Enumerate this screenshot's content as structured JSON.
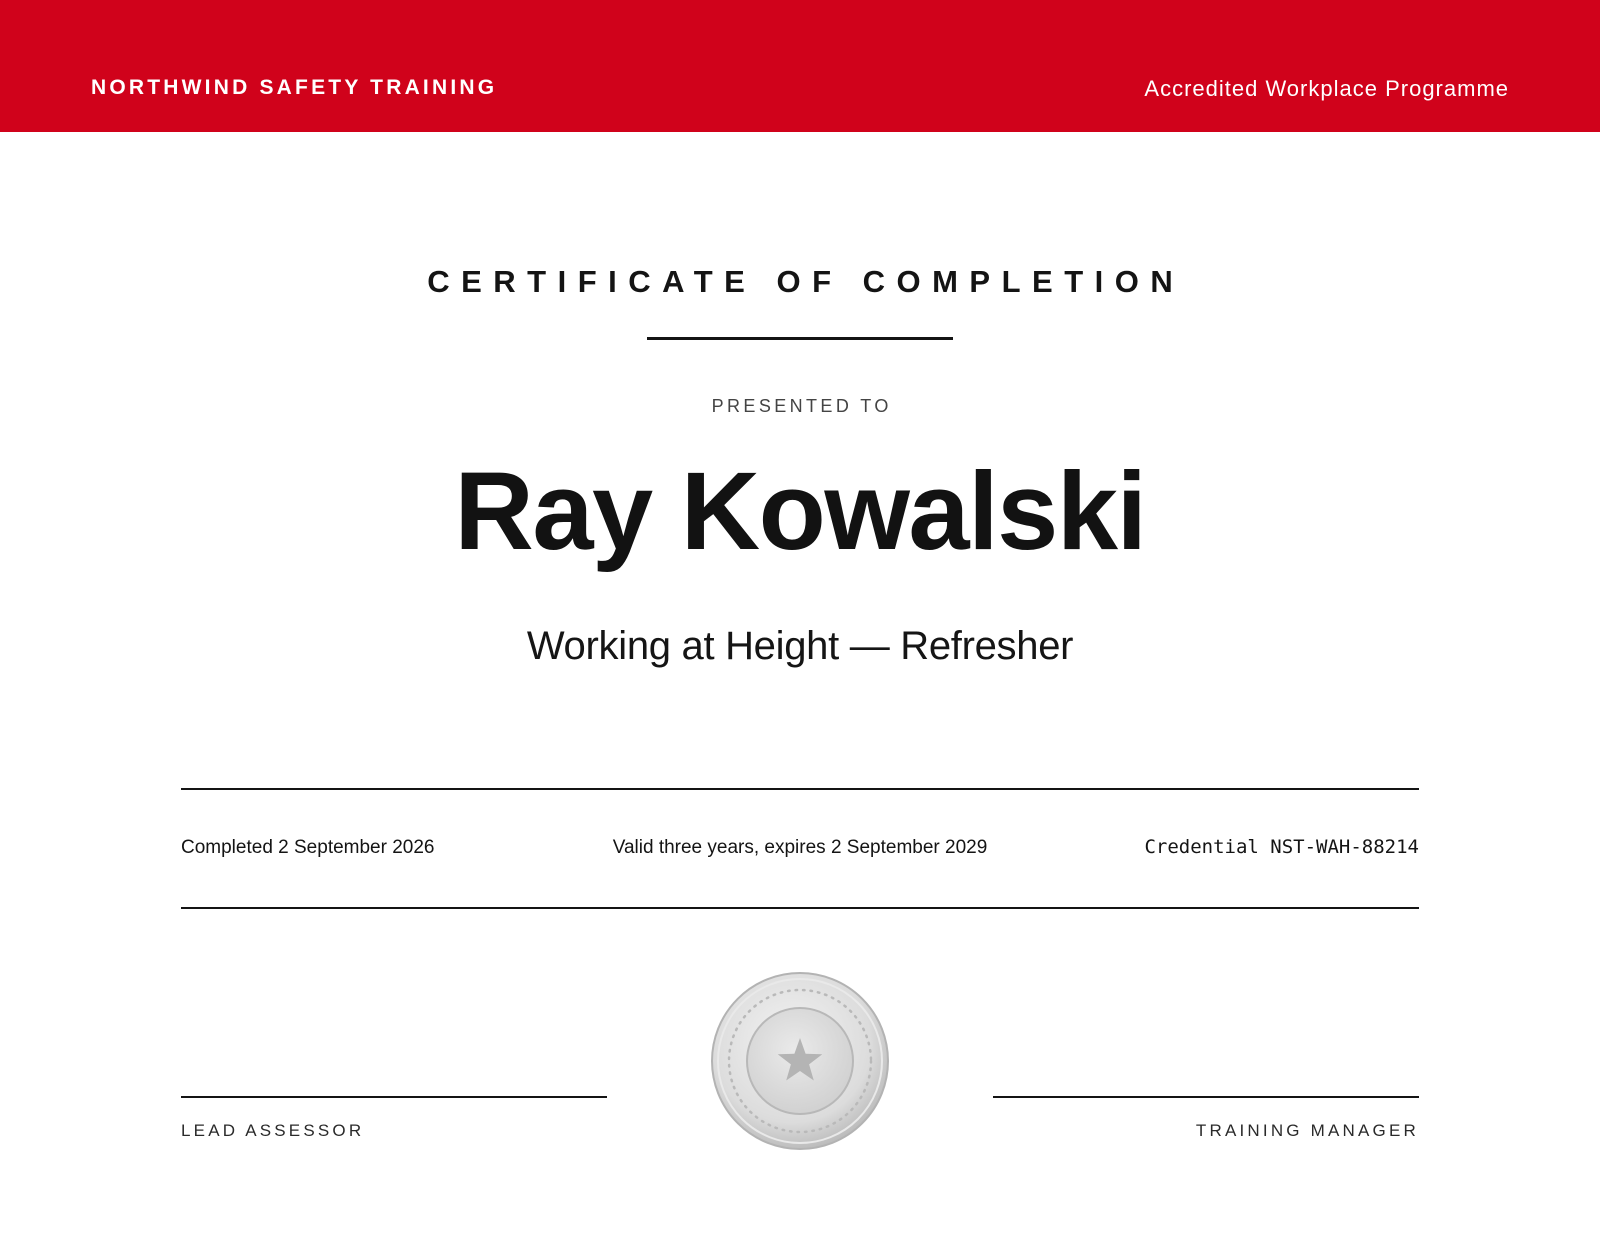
{
  "banner": {
    "organization": "NORTHWIND SAFETY TRAINING",
    "programme": "Accredited Workplace Programme",
    "color": "#d0021b"
  },
  "certificate": {
    "title": "CERTIFICATE OF COMPLETION",
    "presented_label": "PRESENTED TO",
    "recipient": "Ray Kowalski",
    "course": "Working at Height — Refresher"
  },
  "details": {
    "completed": "Completed 2 September 2026",
    "validity": "Valid three years, expires 2 September 2029",
    "credential": "Credential NST-WAH-88214"
  },
  "signatures": {
    "left_label": "LEAD ASSESSOR",
    "right_label": "TRAINING MANAGER"
  },
  "seal": {
    "icon": "star-icon",
    "color": "#d8d8d8"
  }
}
